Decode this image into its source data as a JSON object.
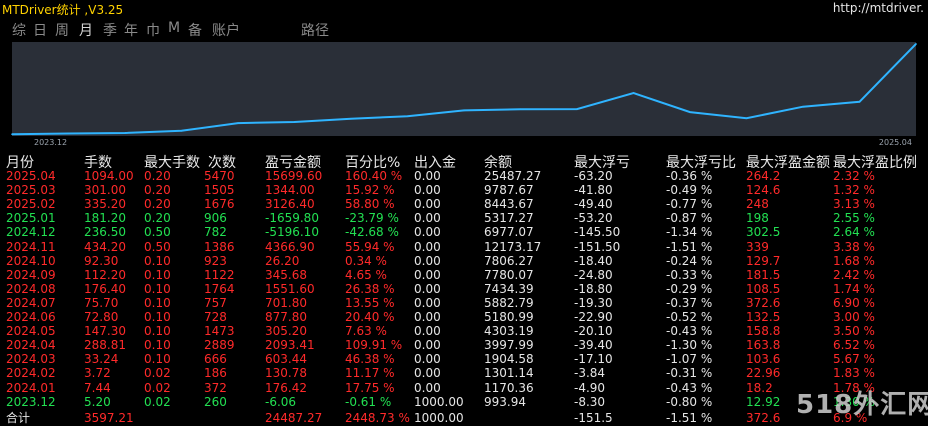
{
  "title": "MTDriver统计 ,V3.25",
  "url": "http://mtdriver.",
  "tabs": [
    "综",
    "日",
    "周",
    "月",
    "季",
    "年",
    "巾",
    "M",
    "备",
    "账户",
    "路径"
  ],
  "active_tab": 3,
  "colors": {
    "positive": "#ff2a2a",
    "negative": "#22e052",
    "neutral": "#e6e6e6",
    "line": "#2fb4ff",
    "chart_bg": "#2a2f38"
  },
  "chart_data": {
    "type": "line",
    "x_start_label": "2023.12",
    "x_end_label": "2025.04",
    "x": [
      "2023.12",
      "2024.01",
      "2024.02",
      "2024.03",
      "2024.04",
      "2024.05",
      "2024.06",
      "2024.07",
      "2024.08",
      "2024.09",
      "2024.10",
      "2024.11",
      "2024.12",
      "2025.01",
      "2025.02",
      "2025.03",
      "2025.04"
    ],
    "values": [
      -6.06,
      170.36,
      301.14,
      904.58,
      2997.99,
      3303.19,
      4180.99,
      4882.79,
      6434.39,
      6780.07,
      6806.27,
      11173.17,
      5977.0,
      4317.27,
      7443.67,
      8787.67,
      24487.27
    ],
    "ylim": [
      -500,
      25000
    ]
  },
  "table": {
    "headers": [
      "月份",
      "手数",
      "最大手数",
      "次数",
      "盈亏金额",
      "百分比%",
      "出入金",
      "余额",
      "最大浮亏",
      "最大浮亏比",
      "最大浮盈金额",
      "最大浮盈比例"
    ],
    "rows": [
      [
        "2025.04",
        "1094.00",
        "0.20",
        "5470",
        "15699.60",
        "160.40 %",
        "0.00",
        "25487.27",
        "-63.20",
        "-0.36 %",
        "264.2",
        "2.32 %"
      ],
      [
        "2025.03",
        "301.00",
        "0.20",
        "1505",
        "1344.00",
        "15.92 %",
        "0.00",
        "9787.67",
        "-41.80",
        "-0.49 %",
        "124.6",
        "1.32 %"
      ],
      [
        "2025.02",
        "335.20",
        "0.20",
        "1676",
        "3126.40",
        "58.80 %",
        "0.00",
        "8443.67",
        "-49.40",
        "-0.77 %",
        "248",
        "3.13 %"
      ],
      [
        "2025.01",
        "181.20",
        "0.20",
        "906",
        "-1659.80",
        "-23.79 %",
        "0.00",
        "5317.27",
        "-53.20",
        "-0.87 %",
        "198",
        "2.55 %"
      ],
      [
        "2024.12",
        "236.50",
        "0.50",
        "782",
        "-5196.10",
        "-42.68 %",
        "0.00",
        "6977.07",
        "-145.50",
        "-1.34 %",
        "302.5",
        "2.64 %"
      ],
      [
        "2024.11",
        "434.20",
        "0.50",
        "1386",
        "4366.90",
        "55.94 %",
        "0.00",
        "12173.17",
        "-151.50",
        "-1.51 %",
        "339",
        "3.38 %"
      ],
      [
        "2024.10",
        "92.30",
        "0.10",
        "923",
        "26.20",
        "0.34 %",
        "0.00",
        "7806.27",
        "-18.40",
        "-0.24 %",
        "129.7",
        "1.68 %"
      ],
      [
        "2024.09",
        "112.20",
        "0.10",
        "1122",
        "345.68",
        "4.65 %",
        "0.00",
        "7780.07",
        "-24.80",
        "-0.33 %",
        "181.5",
        "2.42 %"
      ],
      [
        "2024.08",
        "176.40",
        "0.10",
        "1764",
        "1551.60",
        "26.38 %",
        "0.00",
        "7434.39",
        "-18.80",
        "-0.29 %",
        "108.5",
        "1.74 %"
      ],
      [
        "2024.07",
        "75.70",
        "0.10",
        "757",
        "701.80",
        "13.55 %",
        "0.00",
        "5882.79",
        "-19.30",
        "-0.37 %",
        "372.6",
        "6.90 %"
      ],
      [
        "2024.06",
        "72.80",
        "0.10",
        "728",
        "877.80",
        "20.40 %",
        "0.00",
        "5180.99",
        "-22.90",
        "-0.52 %",
        "132.5",
        "3.00 %"
      ],
      [
        "2024.05",
        "147.30",
        "0.10",
        "1473",
        "305.20",
        "7.63 %",
        "0.00",
        "4303.19",
        "-20.10",
        "-0.43 %",
        "158.8",
        "3.50 %"
      ],
      [
        "2024.04",
        "288.81",
        "0.10",
        "2889",
        "2093.41",
        "109.91 %",
        "0.00",
        "3997.99",
        "-39.40",
        "-1.30 %",
        "163.8",
        "6.52 %"
      ],
      [
        "2024.03",
        "33.24",
        "0.10",
        "666",
        "603.44",
        "46.38 %",
        "0.00",
        "1904.58",
        "-17.10",
        "-1.07 %",
        "103.6",
        "5.67 %"
      ],
      [
        "2024.02",
        "3.72",
        "0.02",
        "186",
        "130.78",
        "11.17 %",
        "0.00",
        "1301.14",
        "-3.84",
        "-0.31 %",
        "22.96",
        "1.83 %"
      ],
      [
        "2024.01",
        "7.44",
        "0.02",
        "372",
        "176.42",
        "17.75 %",
        "0.00",
        "1170.36",
        "-4.90",
        "-0.43 %",
        "18.2",
        "1.78 %"
      ],
      [
        "2023.12",
        "5.20",
        "0.02",
        "260",
        "-6.06",
        "-0.61 %",
        "1000.00",
        "993.94",
        "-8.30",
        "-0.80 %",
        "12.92",
        "1.30 %"
      ]
    ],
    "total": [
      "合计",
      "3597.21",
      "",
      "",
      "24487.27",
      "2448.73 %",
      "1000.00",
      "",
      "-151.5",
      "-1.51 %",
      "372.6",
      "6.9 %"
    ]
  },
  "watermark": "518外汇网"
}
